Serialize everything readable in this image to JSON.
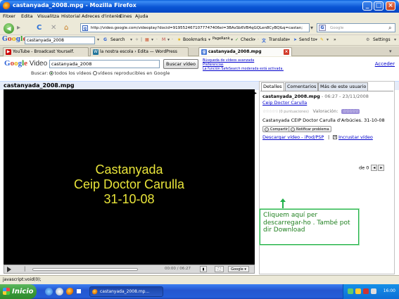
{
  "window": {
    "title": "castanyada_2008.mpg - Mozilla Firefox",
    "controls": {
      "minimize": "_",
      "maximize": "□",
      "close": "×"
    }
  },
  "menu": [
    "Fitxer",
    "Edita",
    "Visualitza",
    "Historial",
    "Adreces d'interès",
    "Eines",
    "Ajuda"
  ],
  "nav": {
    "url": "http://video.google.com/videoplay?docid=9195524671077747406ei=3BAsSb6VB4qGQLen8CyBQ&q=castan;",
    "search_placeholder": "Google",
    "search_engine_icon": "G"
  },
  "google_toolbar": {
    "logo": "Google",
    "query": "castanyada_2008",
    "search_label": "Search",
    "bookmarks_label": "Bookmarks",
    "pagerank_label": "PageRank",
    "check_label": "Check",
    "translate_label": "Translate",
    "sendto_label": "Send to",
    "more_label": "»",
    "settings_label": "Settings"
  },
  "tabs": [
    {
      "label": "YouTube - Broadcast Yourself.",
      "icon": "youtube-icon",
      "color": "#cc0000"
    },
    {
      "label": "la nostra escola › Edita — WordPress",
      "icon": "wordpress-icon",
      "color": "#21759b"
    },
    {
      "label": "castanyada_2008.mpg",
      "icon": "google-icon",
      "color": "#4a7bd8",
      "active": true
    }
  ],
  "page": {
    "logo_google": "Google",
    "logo_video": "Video",
    "search_value": "castanyada_2008",
    "search_button": "Buscar vídeo",
    "links": [
      "Búsqueda de vídeos avanzada",
      "Preferencias",
      "La función SafeSearch moderada está activada."
    ],
    "radio_prefix": "Buscar:",
    "radio_all": "todos los vídeos",
    "radio_playable": "vídeos reproducibles en Google",
    "login": "Acceder",
    "video_title": "castanyada_2008.mpg",
    "video_overlay": [
      "Castanyada",
      "Ceip Doctor Carulla",
      "31-10-08"
    ],
    "time": "00:00 / 06:27",
    "google_btn": "Google ▾"
  },
  "panel": {
    "tabs": [
      "Detalles",
      "Comentarios",
      "Más de este usuario"
    ],
    "title": "castanyada_2008.mpg",
    "date": " - 06:27 - 23/11/2008",
    "author": "Ceip Doctor Carulla",
    "rating_count": "(0 puntuaciones)",
    "rating_label": "Valoración:",
    "description": "Castanyada CEIP Doctor Carulla d'Arbúcies. 31-10-08",
    "share_label": "Compartir",
    "report_label": "Notificar problema",
    "download_label": "Descargar vídeo - iPod/PSP",
    "separator": "|",
    "embed_label": "Incrustar vídeo",
    "pager_text": "de 0"
  },
  "callout": {
    "text": "Cliquem aquí per descarregar-ho . També pot dir Download",
    "color": "#22b14c"
  },
  "status": {
    "text": "javascript:void(0);"
  },
  "taskbar": {
    "start": "Inicio",
    "task_label": "castanyada_2008.mp...",
    "clock": "16:00"
  }
}
